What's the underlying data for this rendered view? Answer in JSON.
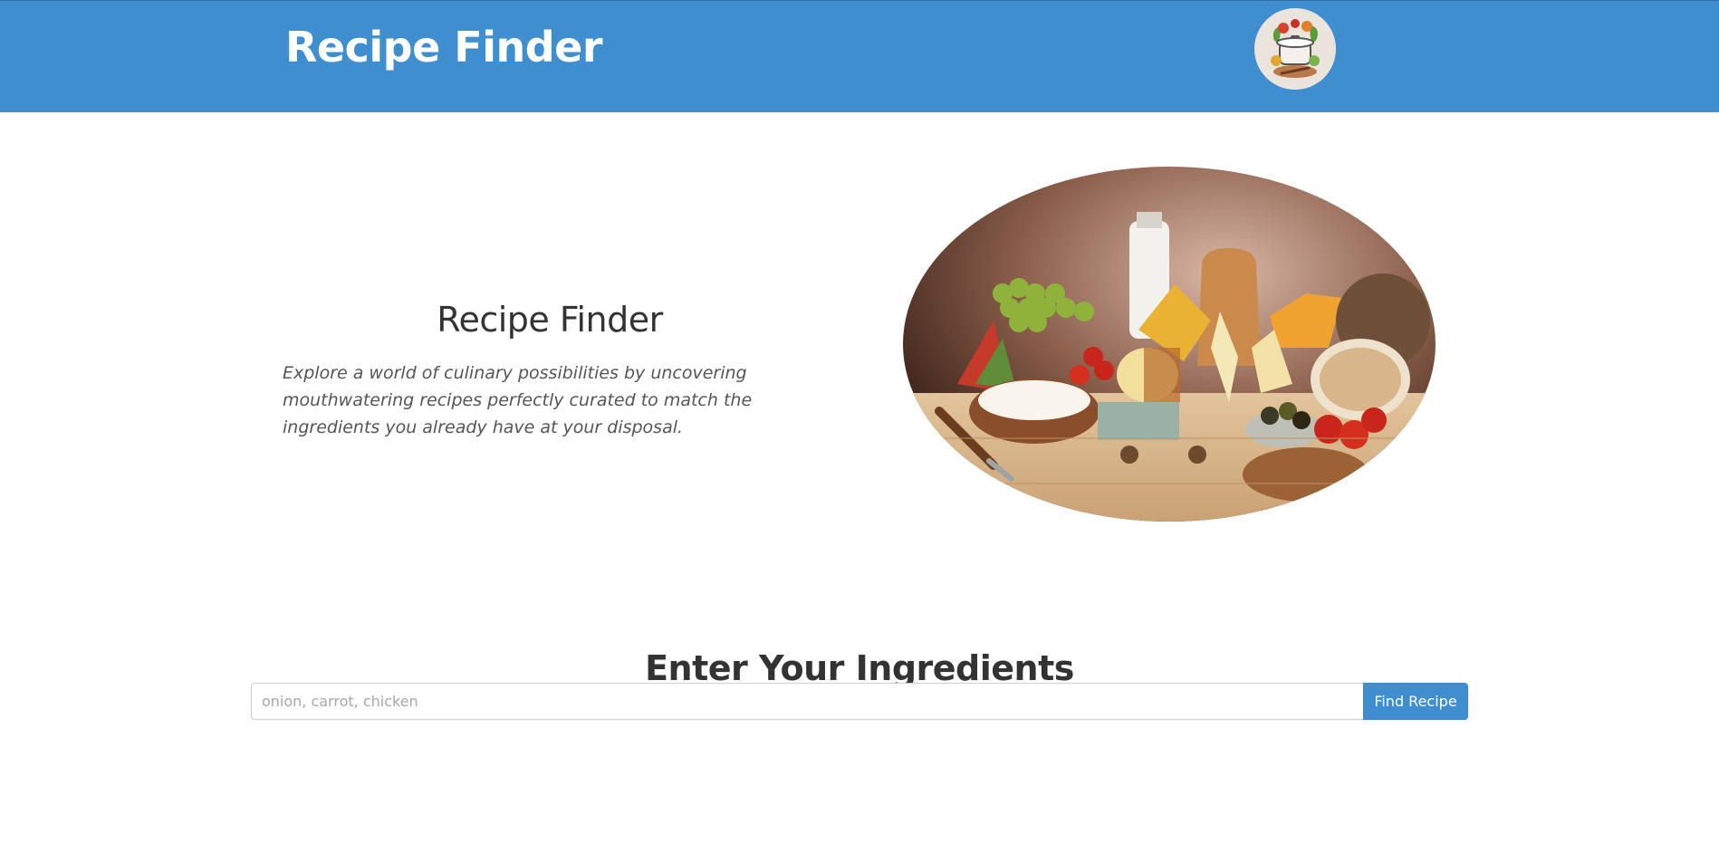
{
  "header": {
    "brand": "Recipe Finder",
    "logo_icon": "cooking-pot-logo-icon"
  },
  "hero": {
    "title": "Recipe Finder",
    "description": "Explore a world of culinary possibilities by uncovering mouthwatering recipes perfectly curated to match the ingredients you already have at your disposal.",
    "image": "ingredients-photo"
  },
  "search": {
    "title": "Enter Your Ingredients",
    "placeholder": "onion, carrot, chicken",
    "value": "",
    "button_label": "Find Recipe"
  },
  "colors": {
    "primary": "#3e8ed0",
    "text": "#333333",
    "muted_text": "#555555"
  }
}
